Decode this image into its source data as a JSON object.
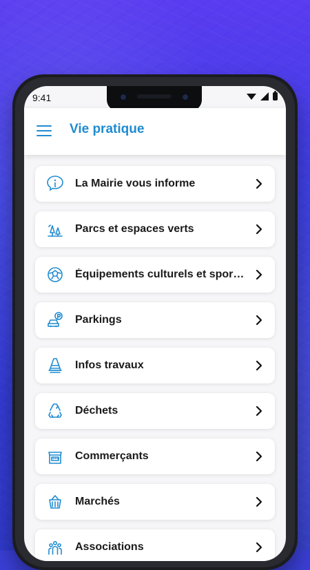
{
  "status": {
    "time": "9:41",
    "icons": [
      "wifi-icon",
      "signal-icon",
      "battery-icon"
    ]
  },
  "appbar": {
    "title": "Vie pratique",
    "menu_icon": "menu-icon"
  },
  "list": {
    "items": [
      {
        "label": "La Mairie vous informe",
        "icon": "info-bubble-icon"
      },
      {
        "label": "Parcs et espaces verts",
        "icon": "park-icon"
      },
      {
        "label": "Équipements culturels et sportifs",
        "icon": "ball-icon"
      },
      {
        "label": "Parkings",
        "icon": "parking-icon"
      },
      {
        "label": "Infos travaux",
        "icon": "traffic-cone-icon"
      },
      {
        "label": "Déchets",
        "icon": "recycle-icon"
      },
      {
        "label": "Commerçants",
        "icon": "shop-icon"
      },
      {
        "label": "Marchés",
        "icon": "basket-icon"
      },
      {
        "label": "Associations",
        "icon": "people-icon"
      }
    ]
  },
  "colors": {
    "accent": "#1f8bd1",
    "text": "#1a1a1a",
    "background": "#f6f6f8",
    "card": "#ffffff"
  }
}
